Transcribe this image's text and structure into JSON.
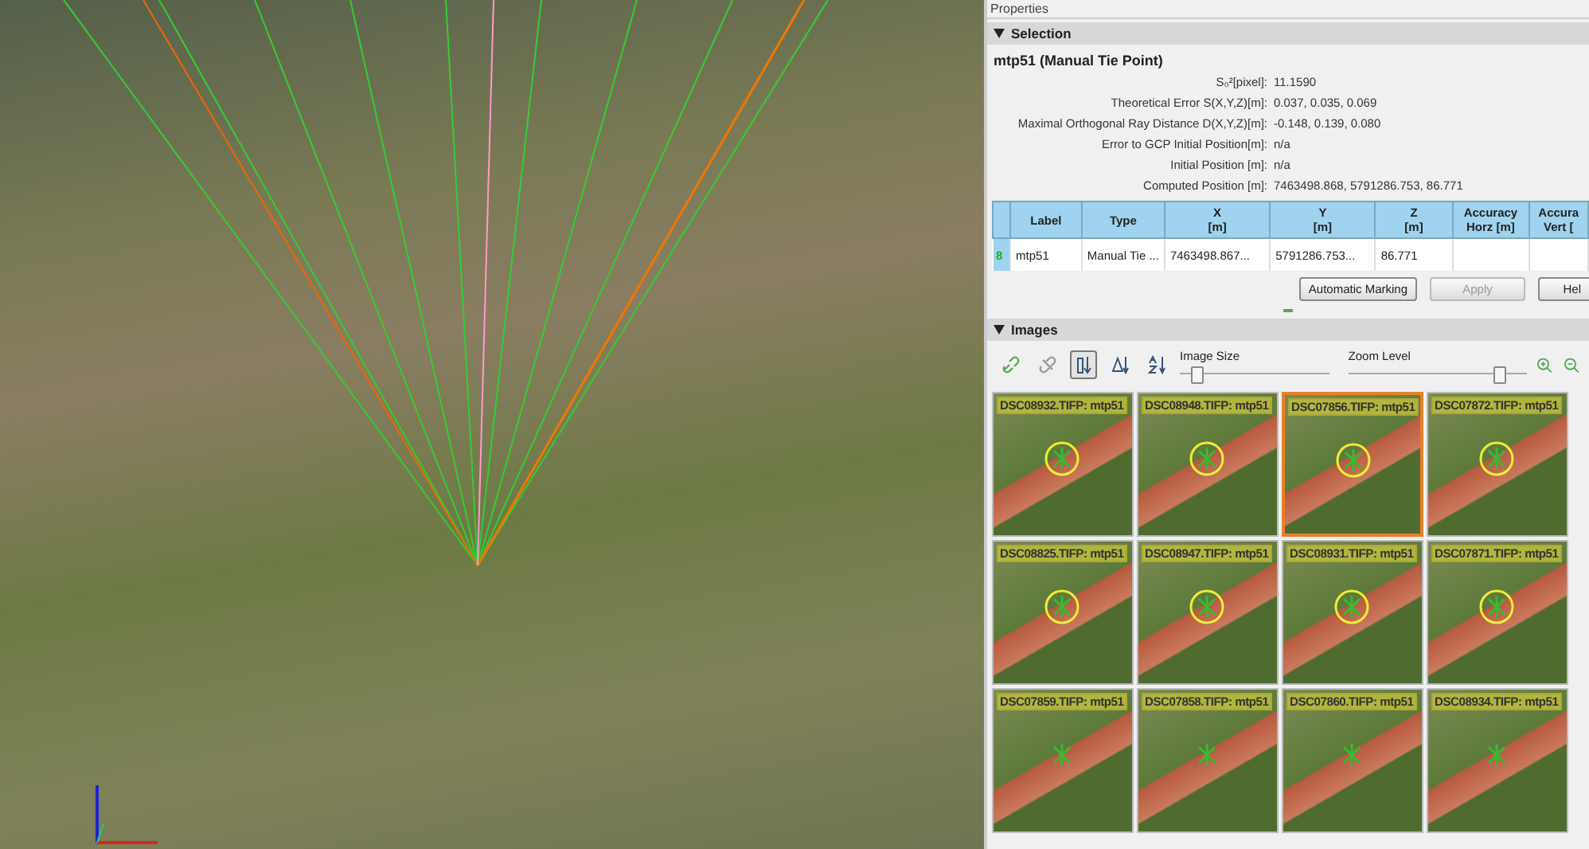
{
  "panel": {
    "title": "Properties"
  },
  "selection": {
    "header": "Selection",
    "title": "mtp51 (Manual Tie Point)",
    "fields": [
      {
        "label": "S₀²[pixel]:",
        "value": "11.1590"
      },
      {
        "label": "Theoretical Error S(X,Y,Z)[m]:",
        "value": "0.037, 0.035, 0.069"
      },
      {
        "label": "Maximal Orthogonal Ray Distance D(X,Y,Z)[m]:",
        "value": "-0.148, 0.139, 0.080"
      },
      {
        "label": "Error to GCP Initial Position[m]:",
        "value": "n/a"
      },
      {
        "label": "Initial Position [m]:",
        "value": "n/a"
      },
      {
        "label": "Computed Position [m]:",
        "value": "7463498.868, 5791286.753, 86.771"
      }
    ],
    "table": {
      "columns": [
        "Label",
        "Type",
        "X\n[m]",
        "Y\n[m]",
        "Z\n[m]",
        "Accuracy\nHorz [m]",
        "Accura\nVert ["
      ],
      "rows": [
        {
          "index": "8",
          "cells": [
            "mtp51",
            "Manual Tie ...",
            "7463498.867...",
            "5791286.753...",
            "86.771"
          ]
        }
      ]
    },
    "buttons": [
      {
        "label": "Automatic Marking",
        "disabled": false
      },
      {
        "label": "Apply",
        "disabled": true
      },
      {
        "label": "Hel",
        "disabled": false
      }
    ]
  },
  "images": {
    "header": "Images",
    "tools": [
      {
        "kind": "link",
        "selected": false
      },
      {
        "kind": "unlink",
        "selected": false
      },
      {
        "kind": "sort-bars",
        "selected": true
      },
      {
        "kind": "sort-delta",
        "selected": false
      },
      {
        "kind": "sort-az",
        "selected": false
      }
    ],
    "sliders": [
      {
        "label": "Image Size",
        "level": 0.12
      },
      {
        "label": "Zoom Level",
        "level": 0.85
      }
    ],
    "tiles": [
      {
        "label": "DSC08932.TIFP: mtp51",
        "selected": false,
        "marked": true
      },
      {
        "label": "DSC08948.TIFP: mtp51",
        "selected": false,
        "marked": true
      },
      {
        "label": "DSC07856.TIFP: mtp51",
        "selected": true,
        "marked": true
      },
      {
        "label": "DSC07872.TIFP: mtp51",
        "selected": false,
        "marked": true
      },
      {
        "label": "DSC08825.TIFP: mtp51",
        "selected": false,
        "marked": true
      },
      {
        "label": "DSC08947.TIFP: mtp51",
        "selected": false,
        "marked": true
      },
      {
        "label": "DSC08931.TIFP: mtp51",
        "selected": false,
        "marked": true
      },
      {
        "label": "DSC07871.TIFP: mtp51",
        "selected": false,
        "marked": true
      },
      {
        "label": "DSC07859.TIFP: mtp51",
        "selected": false,
        "marked": false
      },
      {
        "label": "DSC07858.TIFP: mtp51",
        "selected": false,
        "marked": false
      },
      {
        "label": "DSC07860.TIFP: mtp51",
        "selected": false,
        "marked": false
      },
      {
        "label": "DSC08934.TIFP: mtp51",
        "selected": false,
        "marked": false
      }
    ]
  }
}
